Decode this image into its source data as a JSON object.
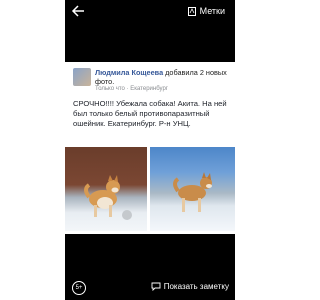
{
  "topbar": {
    "tag_label": "Метки"
  },
  "post": {
    "author": "Людмила Кощеева",
    "action": "добавила 2 новых фото.",
    "time": "Только что",
    "location": "Екатеринбург",
    "text": "СРОЧНО!!!! Убежала собака! Акита. На ней был только белый противопаразитный ошейник. Екатеринбург. Р-н УНЦ."
  },
  "bottombar": {
    "share_label": "5+",
    "note_label": "Показать заметку"
  },
  "colors": {
    "author": "#365899",
    "meta": "#8a8d91",
    "background": "#000000"
  },
  "icons": [
    "back-arrow-icon",
    "tag-icon",
    "share-icon",
    "comment-icon",
    "globe-icon"
  ]
}
